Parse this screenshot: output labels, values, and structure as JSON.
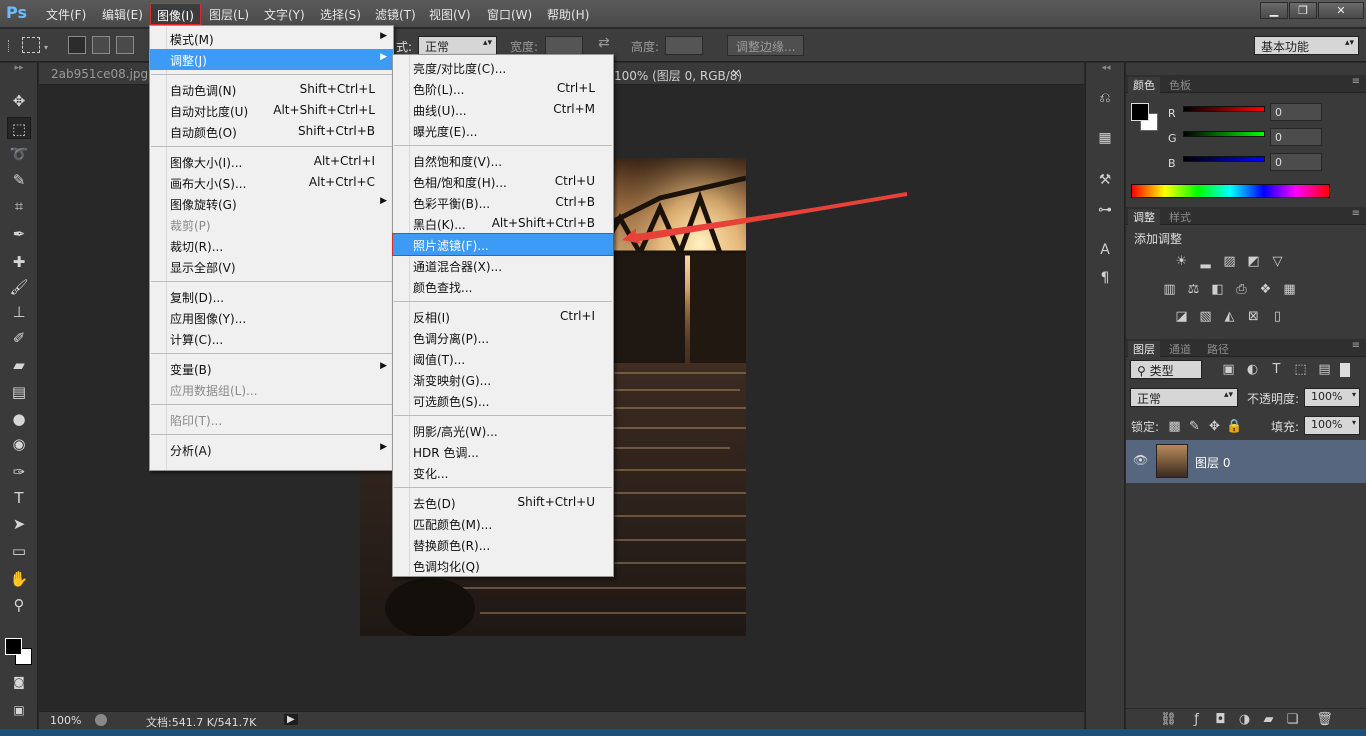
{
  "app": {
    "logo": "Ps",
    "menu": [
      "文件(F)",
      "编辑(E)",
      "图像(I)",
      "图层(L)",
      "文字(Y)",
      "选择(S)",
      "滤镜(T)",
      "视图(V)",
      "窗口(W)",
      "帮助(H)"
    ],
    "window_controls": [
      "minimize-icon",
      "restore-icon",
      "close-icon"
    ]
  },
  "options": {
    "style_label": "式:",
    "style_value": "正常",
    "width_label": "宽度:",
    "height_label": "高度:",
    "refine_button": "调整边缘...",
    "workspace": "基本功能"
  },
  "document": {
    "tab": "2ab951ce08.jpg @",
    "tab_suffix": "100% (图层 0, RGB/8)",
    "close": "×",
    "zoom": "100%",
    "doc_size": "文档:541.7 K/541.7K"
  },
  "image_menu": {
    "items": [
      {
        "label": "模式(M)",
        "submenu": true
      },
      {
        "label": "调整(J)",
        "submenu": true,
        "highlight": true
      },
      {
        "label": "自动色调(N)",
        "shortcut": "Shift+Ctrl+L"
      },
      {
        "label": "自动对比度(U)",
        "shortcut": "Alt+Shift+Ctrl+L"
      },
      {
        "label": "自动颜色(O)",
        "shortcut": "Shift+Ctrl+B"
      },
      {
        "label": "图像大小(I)...",
        "shortcut": "Alt+Ctrl+I"
      },
      {
        "label": "画布大小(S)...",
        "shortcut": "Alt+Ctrl+C"
      },
      {
        "label": "图像旋转(G)",
        "submenu": true
      },
      {
        "label": "裁剪(P)",
        "disabled": true
      },
      {
        "label": "裁切(R)..."
      },
      {
        "label": "显示全部(V)"
      },
      {
        "label": "复制(D)..."
      },
      {
        "label": "应用图像(Y)..."
      },
      {
        "label": "计算(C)..."
      },
      {
        "label": "变量(B)",
        "submenu": true
      },
      {
        "label": "应用数据组(L)...",
        "disabled": true
      },
      {
        "label": "陷印(T)...",
        "disabled": true
      },
      {
        "label": "分析(A)",
        "submenu": true
      }
    ]
  },
  "adjust_menu": {
    "items": [
      {
        "label": "亮度/对比度(C)..."
      },
      {
        "label": "色阶(L)...",
        "shortcut": "Ctrl+L"
      },
      {
        "label": "曲线(U)...",
        "shortcut": "Ctrl+M"
      },
      {
        "label": "曝光度(E)..."
      },
      {
        "label": "自然饱和度(V)..."
      },
      {
        "label": "色相/饱和度(H)...",
        "shortcut": "Ctrl+U"
      },
      {
        "label": "色彩平衡(B)...",
        "shortcut": "Ctrl+B"
      },
      {
        "label": "黑白(K)...",
        "shortcut": "Alt+Shift+Ctrl+B"
      },
      {
        "label": "照片滤镜(F)...",
        "highlight": true
      },
      {
        "label": "通道混合器(X)..."
      },
      {
        "label": "颜色查找..."
      },
      {
        "label": "反相(I)",
        "shortcut": "Ctrl+I"
      },
      {
        "label": "色调分离(P)..."
      },
      {
        "label": "阈值(T)..."
      },
      {
        "label": "渐变映射(G)..."
      },
      {
        "label": "可选颜色(S)..."
      },
      {
        "label": "阴影/高光(W)..."
      },
      {
        "label": "HDR 色调..."
      },
      {
        "label": "变化..."
      },
      {
        "label": "去色(D)",
        "shortcut": "Shift+Ctrl+U"
      },
      {
        "label": "匹配颜色(M)..."
      },
      {
        "label": "替换颜色(R)..."
      },
      {
        "label": "色调均化(Q)"
      }
    ]
  },
  "color_panel": {
    "tabs": [
      "颜色",
      "色板"
    ],
    "channels": [
      {
        "name": "R",
        "value": "0",
        "color": "#ff0000"
      },
      {
        "name": "G",
        "value": "0",
        "color": "#00ff00"
      },
      {
        "name": "B",
        "value": "0",
        "color": "#0000ff"
      }
    ]
  },
  "adjust_panel": {
    "tabs": [
      "调整",
      "样式"
    ],
    "title": "添加调整"
  },
  "layers_panel": {
    "tabs": [
      "图层",
      "通道",
      "路径"
    ],
    "filter": "类型",
    "blend_mode": "正常",
    "opacity_label": "不透明度:",
    "opacity": "100%",
    "lock_label": "锁定:",
    "fill_label": "填充:",
    "fill": "100%",
    "layers": [
      {
        "name": "图层 0",
        "visible": true
      }
    ]
  },
  "colors": {
    "accent": "#3d9bf5",
    "highlight_border": "#e02a2a",
    "arrow": "#e8413a"
  }
}
